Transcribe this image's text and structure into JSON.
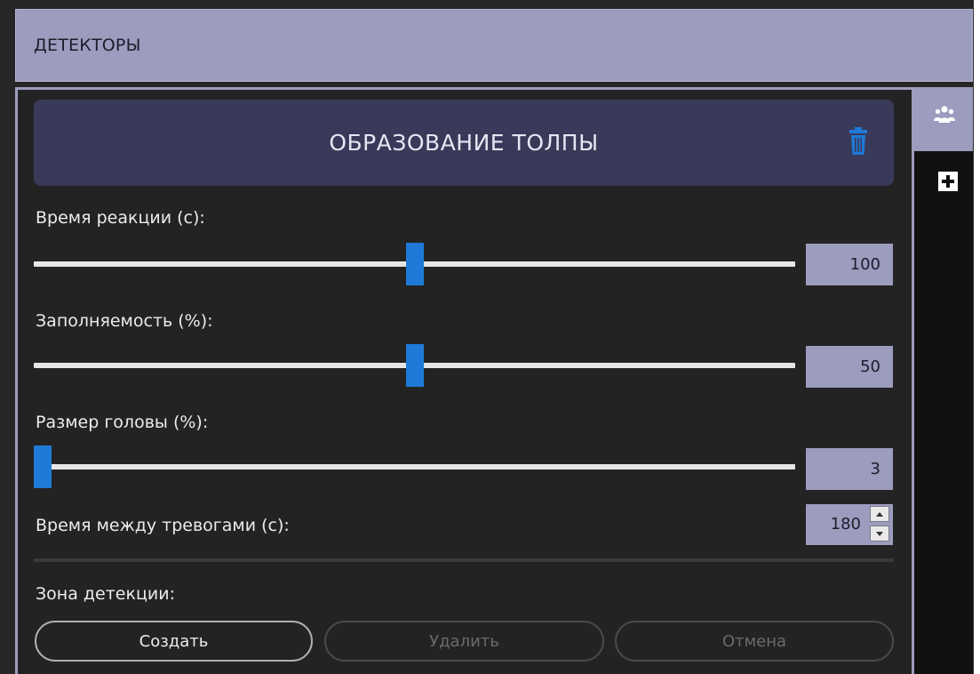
{
  "header": {
    "title": "ДЕТЕКТОРЫ"
  },
  "card": {
    "title": "ОБРАЗОВАНИЕ ТОЛПЫ",
    "delete_icon": "trash-icon"
  },
  "settings": {
    "reaction_time": {
      "label": "Время реакции (с):",
      "value": "100",
      "slider_fraction": 0.5
    },
    "fill_rate": {
      "label": "Заполняемость (%):",
      "value": "50",
      "slider_fraction": 0.5
    },
    "head_size": {
      "label": "Размер головы (%):",
      "value": "3",
      "slider_fraction": 0.0
    },
    "alarm_interval": {
      "label": "Время между тревогами (с):",
      "value": "180"
    }
  },
  "zone": {
    "label": "Зона детекции:",
    "create_label": "Создать",
    "delete_label": "Удалить",
    "cancel_label": "Отмена"
  },
  "side_tabs": [
    {
      "icon": "crowd-icon",
      "active": true
    },
    {
      "icon": "plus-icon",
      "active": false
    }
  ],
  "colors": {
    "accent": "#1e7ad6",
    "header_bg": "#9c9cbf",
    "card_bg": "#39395a",
    "panel_bg": "#232323"
  }
}
